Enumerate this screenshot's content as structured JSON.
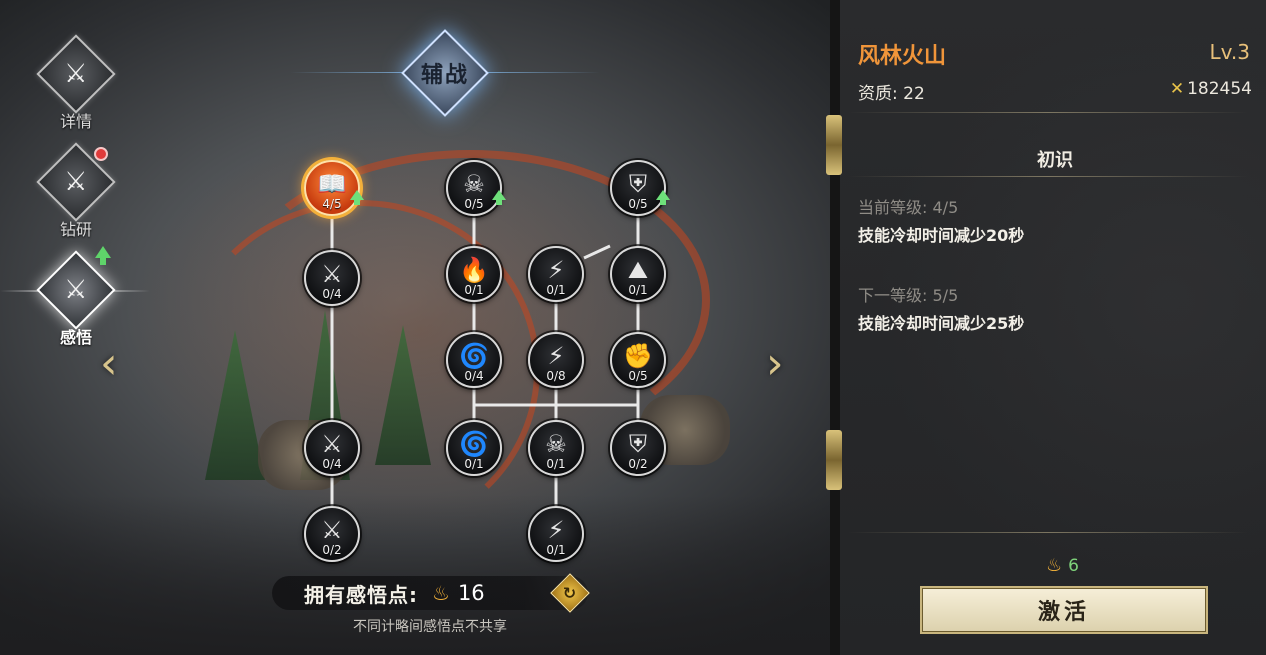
{
  "tabs": [
    {
      "label": "详情"
    },
    {
      "label": "钻研"
    },
    {
      "label": "感悟"
    }
  ],
  "emblem_text": "辅战",
  "nodes": [
    {
      "count": "4/5",
      "icon": "book-flame-icon"
    },
    {
      "count": "0/5",
      "icon": "demon-mask-icon"
    },
    {
      "count": "0/5",
      "icon": "shield-icon"
    },
    {
      "count": "0/4",
      "icon": "sword-book-icon"
    },
    {
      "count": "0/1",
      "icon": "flame-icon"
    },
    {
      "count": "0/1",
      "icon": "lightning-icon"
    },
    {
      "count": "0/1",
      "icon": "mountain-icon"
    },
    {
      "count": "0/4",
      "icon": "swirl-icon"
    },
    {
      "count": "0/8",
      "icon": "lightning-icon"
    },
    {
      "count": "0/5",
      "icon": "rock-fist-icon"
    },
    {
      "count": "0/4",
      "icon": "sword-book-icon"
    },
    {
      "count": "0/1",
      "icon": "swirl-icon"
    },
    {
      "count": "0/1",
      "icon": "demon-mask-icon"
    },
    {
      "count": "0/2",
      "icon": "shield-icon"
    },
    {
      "count": "0/2",
      "icon": "sword-book-icon"
    },
    {
      "count": "0/1",
      "icon": "lightning-icon"
    }
  ],
  "points": {
    "label": "拥有感悟点:",
    "value": "16",
    "note": "不同计略间感悟点不共享"
  },
  "skill": {
    "name": "风林火山",
    "level": "Lv.3",
    "quality_label": "资质:",
    "quality_value": "22",
    "power": "182454",
    "section_title": "初识",
    "current_label": "当前等级:",
    "current_level": "4/5",
    "current_effect": "技能冷却时间减少20秒",
    "next_label": "下一等级:",
    "next_level": "5/5",
    "next_effect": "技能冷却时间减少25秒",
    "cost": "6",
    "activate_label": "激活"
  },
  "colors": {
    "skill_name": "#f0953a",
    "accent_gold": "#e8c07a",
    "active_node": "#f3b03a",
    "cost_green": "#7fd37b"
  }
}
